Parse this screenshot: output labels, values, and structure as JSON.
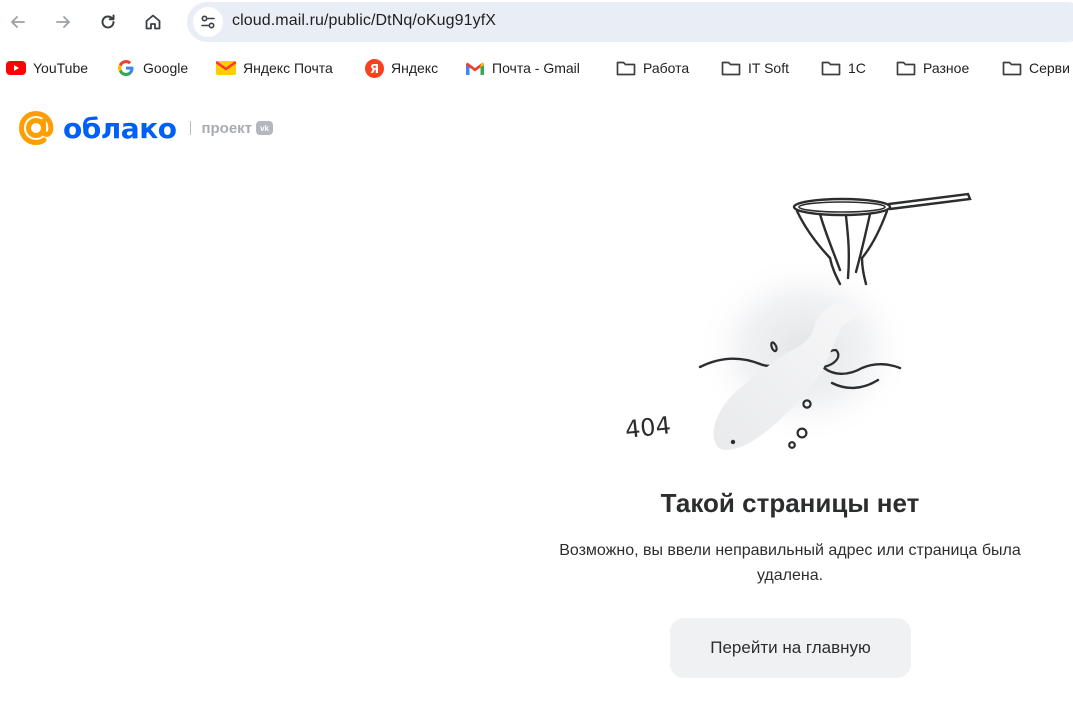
{
  "browser": {
    "url": "cloud.mail.ru/public/DtNq/oKug91yfX",
    "bookmarks": [
      {
        "label": "YouTube",
        "icon": "youtube-icon"
      },
      {
        "label": "Google",
        "icon": "google-icon"
      },
      {
        "label": "Яндекс Почта",
        "icon": "yandex-mail-icon"
      },
      {
        "label": "Яндекс",
        "icon": "yandex-icon"
      },
      {
        "label": "Почта - Gmail",
        "icon": "gmail-icon"
      },
      {
        "label": "Работа",
        "icon": "folder-icon"
      },
      {
        "label": "IT Soft",
        "icon": "folder-icon"
      },
      {
        "label": "1С",
        "icon": "folder-icon"
      },
      {
        "label": "Разное",
        "icon": "folder-icon"
      },
      {
        "label": "Серви",
        "icon": "folder-icon"
      }
    ]
  },
  "header": {
    "logo_text": "облако",
    "logo_project": "проект",
    "logo_vk": "vk",
    "brand_color": "#005ff9",
    "at_color": "#ff9e00"
  },
  "error": {
    "code": "404",
    "title": "Такой страницы нет",
    "description": "Возможно, вы ввели неправильный адрес или страница была удалена.",
    "button_label": "Перейти на главную"
  }
}
